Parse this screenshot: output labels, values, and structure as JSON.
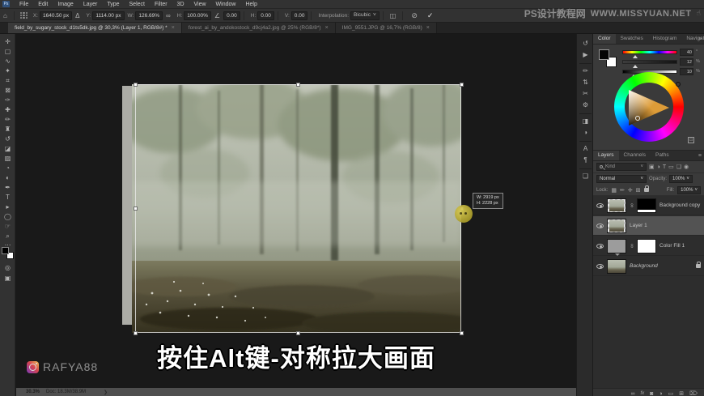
{
  "menubar": {
    "app_icon": "Ps",
    "items": [
      "File",
      "Edit",
      "Image",
      "Layer",
      "Type",
      "Select",
      "Filter",
      "3D",
      "View",
      "Window",
      "Help"
    ]
  },
  "options": {
    "home_icon": "⌂",
    "x_label": "X:",
    "x_value": "1640.50 px",
    "delta_icon": "Δ",
    "y_label": "Y:",
    "y_value": "1114.00 px",
    "w_label": "W:",
    "w_value": "126.69%",
    "link_icon": "∞",
    "h_label": "H:",
    "h_value": "100.00%",
    "angle_icon": "∠",
    "angle_value": "0.00",
    "skew_h_label": "H:",
    "skew_h_value": "0.00",
    "skew_v_label": "V:",
    "skew_v_value": "0.00",
    "interp_label": "Interpolation:",
    "interp_value": "Bicubic",
    "warp_icon": "◫",
    "cancel_icon": "⊘",
    "commit_icon": "✓"
  },
  "tabs": [
    {
      "title": "field_by_sugary_stock_d1ts5dk.jpg @ 30,3% (Layer 1, RGB/8#) *",
      "close": "×",
      "active": true
    },
    {
      "title": "forest_ai_by_andokostock_d9cj4a2.jpg @ 25% (RGB/8*)",
      "close": "×",
      "active": false
    },
    {
      "title": "IMG_9551.JPG @ 16,7% (RGB/8)",
      "close": "×",
      "active": false
    }
  ],
  "tools": [
    {
      "name": "move-tool",
      "glyph": "✛"
    },
    {
      "name": "marquee-tool",
      "glyph": "▢"
    },
    {
      "name": "lasso-tool",
      "glyph": "∿"
    },
    {
      "name": "quick-selection-tool",
      "glyph": "✦"
    },
    {
      "name": "crop-tool",
      "glyph": "⌗"
    },
    {
      "name": "frame-tool",
      "glyph": "⊠"
    },
    {
      "name": "eyedropper-tool",
      "glyph": "✑"
    },
    {
      "name": "healing-brush-tool",
      "glyph": "✚"
    },
    {
      "name": "brush-tool",
      "glyph": "✏"
    },
    {
      "name": "clone-stamp-tool",
      "glyph": "♜"
    },
    {
      "name": "history-brush-tool",
      "glyph": "↺"
    },
    {
      "name": "eraser-tool",
      "glyph": "◪"
    },
    {
      "name": "gradient-tool",
      "glyph": "▨"
    },
    {
      "name": "blur-tool",
      "glyph": "◔"
    },
    {
      "name": "dodge-tool",
      "glyph": "◐"
    },
    {
      "name": "pen-tool",
      "glyph": "✒"
    },
    {
      "name": "type-tool",
      "glyph": "T"
    },
    {
      "name": "path-selection-tool",
      "glyph": "▸"
    },
    {
      "name": "shape-tool",
      "glyph": "◯"
    },
    {
      "name": "hand-tool",
      "glyph": "☞"
    },
    {
      "name": "zoom-tool",
      "glyph": "⌕"
    },
    {
      "name": "edit-toolbar",
      "glyph": "⋯"
    },
    {
      "name": "quick-mask",
      "glyph": "◎"
    },
    {
      "name": "screen-mode",
      "glyph": "▣"
    }
  ],
  "dock": [
    {
      "name": "history-panel-icon",
      "glyph": "↺"
    },
    {
      "name": "actions-panel-icon",
      "glyph": "▶"
    },
    {
      "name": "brush-settings-panel-icon",
      "glyph": "✏"
    },
    {
      "name": "brushes-panel-icon",
      "glyph": "⇅"
    },
    {
      "name": "glyphs-panel-icon",
      "glyph": "✂"
    },
    {
      "name": "properties-panel-icon",
      "glyph": "⚙"
    },
    {
      "name": "info-panel-icon",
      "glyph": "◨"
    },
    {
      "name": "adjustments-panel-icon",
      "glyph": "◑"
    },
    {
      "name": "character-panel-icon",
      "glyph": "A"
    },
    {
      "name": "paragraph-panel-icon",
      "glyph": "¶"
    },
    {
      "name": "libraries-panel-icon",
      "glyph": "❏"
    }
  ],
  "color_panel": {
    "tabs": [
      "Color",
      "Swatches",
      "Histogram",
      "Navigator"
    ],
    "menu_icon": "≡",
    "hue": {
      "value": "40",
      "unit": "°"
    },
    "sat": {
      "value": "12",
      "unit": "%"
    },
    "bri": {
      "value": "10",
      "unit": "%"
    },
    "wheel_button": "⊡"
  },
  "layers_panel": {
    "tabs": [
      "Layers",
      "Channels",
      "Paths"
    ],
    "menu_icon": "≡",
    "search_label": "Kind",
    "search_chevron": "˅",
    "filter_icons": [
      "▣",
      "◑",
      "T",
      "▭",
      "❏"
    ],
    "pin_icon": "◉",
    "blend_mode": "Normal",
    "blend_chevron": "˅",
    "opacity_label": "Opacity:",
    "opacity_value": "100%",
    "lock_label": "Lock:",
    "lock_icons": [
      "▦",
      "✏",
      "✛",
      "⊞"
    ],
    "fill_label": "Fill:",
    "fill_value": "100%",
    "link_glyph": "∞",
    "layers": [
      {
        "name": "Background copy"
      },
      {
        "name": "Layer 1"
      },
      {
        "name": "Color Fill 1"
      },
      {
        "name": "Background"
      }
    ],
    "bottom_icons": {
      "link": "∞",
      "fx": "fx",
      "mask": "◙",
      "adjust": "◑",
      "group": "▭",
      "new": "⊞",
      "trash": "⌦"
    }
  },
  "canvas": {
    "tooltip_w": "W:  2919 px",
    "tooltip_h": "H:  2228 px"
  },
  "subtitle": "按住Alt键-对称拉大画面",
  "creator": "RAFYA88",
  "watermark": {
    "cn": "PS设计教程网",
    "url": "WWW.MISSYUAN.NET",
    "hand": "☝"
  },
  "statusbar": {
    "zoom": "30.3%",
    "doc": "Doc: 18.3M/38.9M",
    "chevron": "❯"
  }
}
